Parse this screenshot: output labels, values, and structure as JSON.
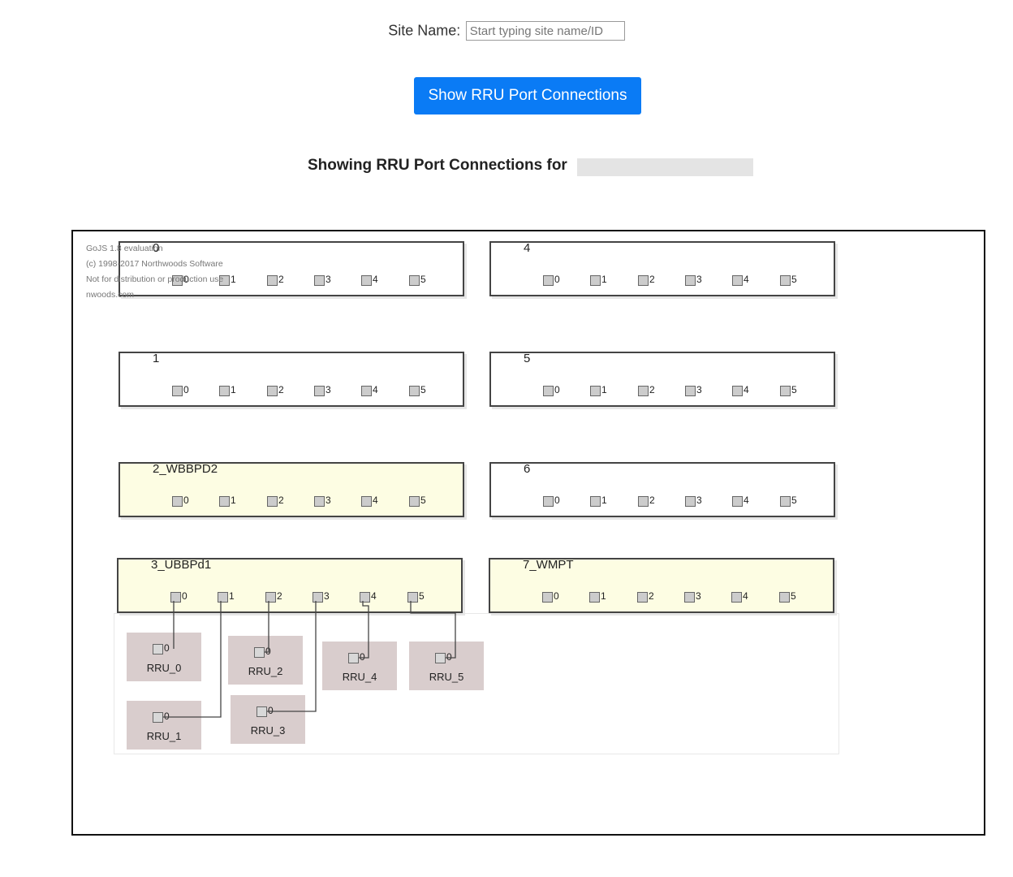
{
  "site": {
    "label": "Site Name:",
    "placeholder": "Start typing site name/ID",
    "value": ""
  },
  "button_label": "Show RRU Port Connections",
  "heading": "Showing RRU Port Connections for",
  "watermark": [
    "GoJS 1.8 evaluation",
    "(c) 1998-2017 Northwoods Software",
    "Not for distribution or production use",
    "nwoods.com"
  ],
  "boards": [
    {
      "label": "0",
      "highlight": false,
      "ports": [
        "0",
        "1",
        "2",
        "3",
        "4",
        "5"
      ]
    },
    {
      "label": "1",
      "highlight": false,
      "ports": [
        "0",
        "1",
        "2",
        "3",
        "4",
        "5"
      ]
    },
    {
      "label": "2_WBBPD2",
      "highlight": true,
      "ports": [
        "0",
        "1",
        "2",
        "3",
        "4",
        "5"
      ]
    },
    {
      "label": "3_UBBPd1",
      "highlight": true,
      "ports": [
        "0",
        "1",
        "2",
        "3",
        "4",
        "5"
      ]
    },
    {
      "label": "4",
      "highlight": false,
      "ports": [
        "0",
        "1",
        "2",
        "3",
        "4",
        "5"
      ]
    },
    {
      "label": "5",
      "highlight": false,
      "ports": [
        "0",
        "1",
        "2",
        "3",
        "4",
        "5"
      ]
    },
    {
      "label": "6",
      "highlight": false,
      "ports": [
        "0",
        "1",
        "2",
        "3",
        "4",
        "5"
      ]
    },
    {
      "label": "7_WMPT",
      "highlight": true,
      "ports": [
        "0",
        "1",
        "2",
        "3",
        "4",
        "5"
      ]
    }
  ],
  "rrus": [
    {
      "label": "RRU_0",
      "port": "0",
      "linked_port": "0"
    },
    {
      "label": "RRU_1",
      "port": "0",
      "linked_port": "1"
    },
    {
      "label": "RRU_2",
      "port": "0",
      "linked_port": "2"
    },
    {
      "label": "RRU_3",
      "port": "0",
      "linked_port": "3"
    },
    {
      "label": "RRU_4",
      "port": "0",
      "linked_port": "4"
    },
    {
      "label": "RRU_5",
      "port": "0",
      "linked_port": "5"
    }
  ],
  "colors": {
    "button": "#0a7bf5",
    "board_highlight": "#fdfde3",
    "rru_fill": "#d9cdcd"
  }
}
